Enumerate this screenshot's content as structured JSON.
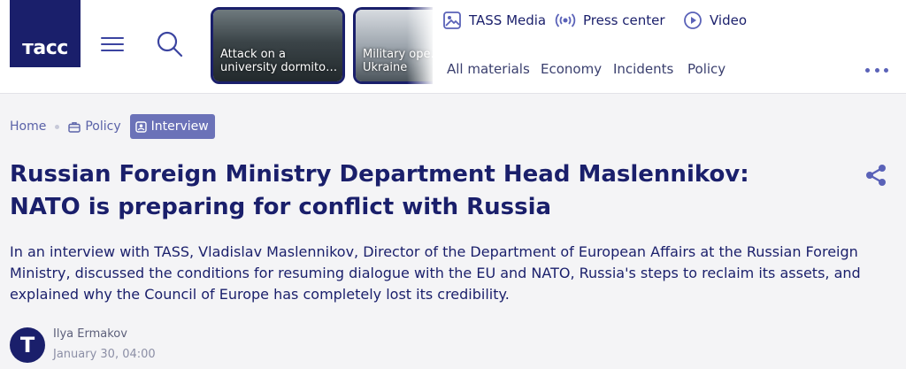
{
  "header": {
    "logo_text": "тасс",
    "stories": [
      {
        "caption": "Attack on a university dormito…"
      },
      {
        "caption": "Military ope… Ukraine"
      }
    ],
    "top_links": [
      {
        "label": "TASS Media",
        "icon": "image-icon"
      },
      {
        "label": "Press center",
        "icon": "broadcast-icon"
      },
      {
        "label": "Video",
        "icon": "play-circle-icon"
      }
    ],
    "sections": [
      "All materials",
      "Economy",
      "Incidents",
      "Policy"
    ]
  },
  "breadcrumbs": {
    "home": "Home",
    "policy": "Policy",
    "interview": "Interview"
  },
  "article": {
    "title": "Russian Foreign Ministry Department Head Maslennikov: NATO is preparing for conflict with Russia",
    "lead": "In an interview with TASS, Vladislav Maslennikov, Director of the Department of European Affairs at the Russian Foreign Ministry, discussed the conditions for resuming dialogue with the EU and NATO, Russia's steps to reclaim its assets, and explained why the Council of Europe has completely lost its credibility.",
    "author_initial": "T",
    "author": "Ilya Ermakov",
    "date": "January 30, 04:00"
  },
  "colors": {
    "brand": "#1a1f6b",
    "accent": "#6b72b8",
    "background": "#f4f4f6"
  }
}
